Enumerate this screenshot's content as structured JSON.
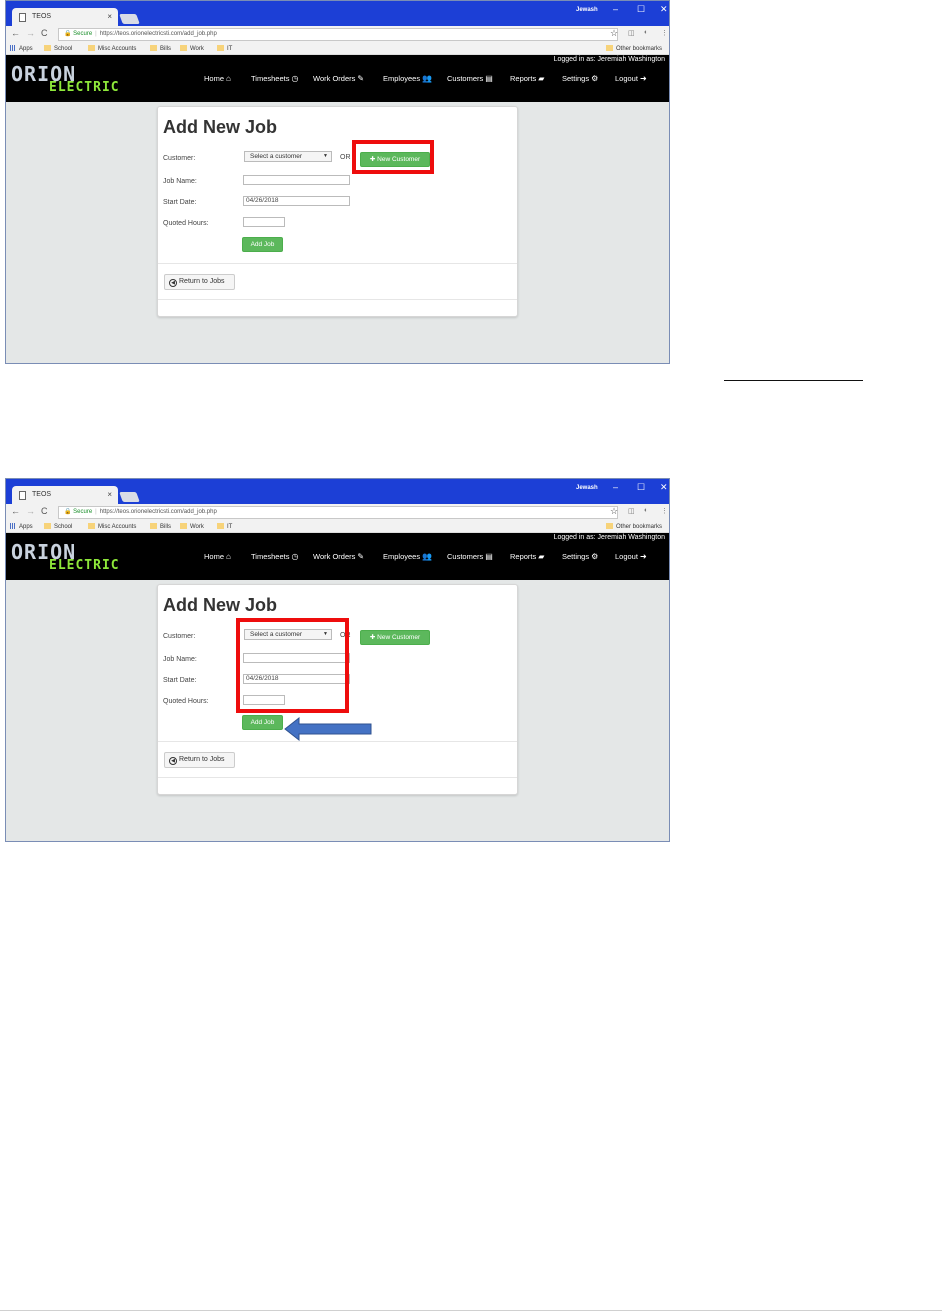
{
  "browser": {
    "tab_title": "TEOS",
    "profile_name": "Jewash",
    "secure_label": "Secure",
    "url_prefix": "https://",
    "url_domain": "teos.orionelectricsti.com",
    "url_path": "/add_job.php",
    "bookmarks": [
      "Apps",
      "School",
      "Misc Accounts",
      "Bills",
      "Work",
      "IT"
    ],
    "other_bookmarks": "Other bookmarks"
  },
  "app": {
    "logo_line1": "ORION",
    "logo_line2": "ELECTRIC",
    "logged_in": "Logged in as: Jeremiah Washington",
    "nav": [
      {
        "label": "Home",
        "icon": "home-icon"
      },
      {
        "label": "Timesheets",
        "icon": "clock-icon"
      },
      {
        "label": "Work Orders",
        "icon": "edit-icon"
      },
      {
        "label": "Employees",
        "icon": "users-icon"
      },
      {
        "label": "Customers",
        "icon": "card-icon"
      },
      {
        "label": "Reports",
        "icon": "book-icon"
      },
      {
        "label": "Settings",
        "icon": "gears-icon"
      },
      {
        "label": "Logout",
        "icon": "logout-icon"
      }
    ]
  },
  "form": {
    "title": "Add New Job",
    "customer_label": "Customer:",
    "customer_select": "Select a customer",
    "or_label": "OR",
    "new_customer_button": "New Customer",
    "job_name_label": "Job Name:",
    "job_name_value": "",
    "start_date_label": "Start Date:",
    "start_date_value": "04/26/2018",
    "quoted_hours_label": "Quoted Hours:",
    "quoted_hours_value": "",
    "add_job_button": "Add Job",
    "return_button": "Return to Jobs"
  },
  "annotations": {
    "highlight_color": "#ee0d0d",
    "arrow_color": "#4472c4"
  }
}
